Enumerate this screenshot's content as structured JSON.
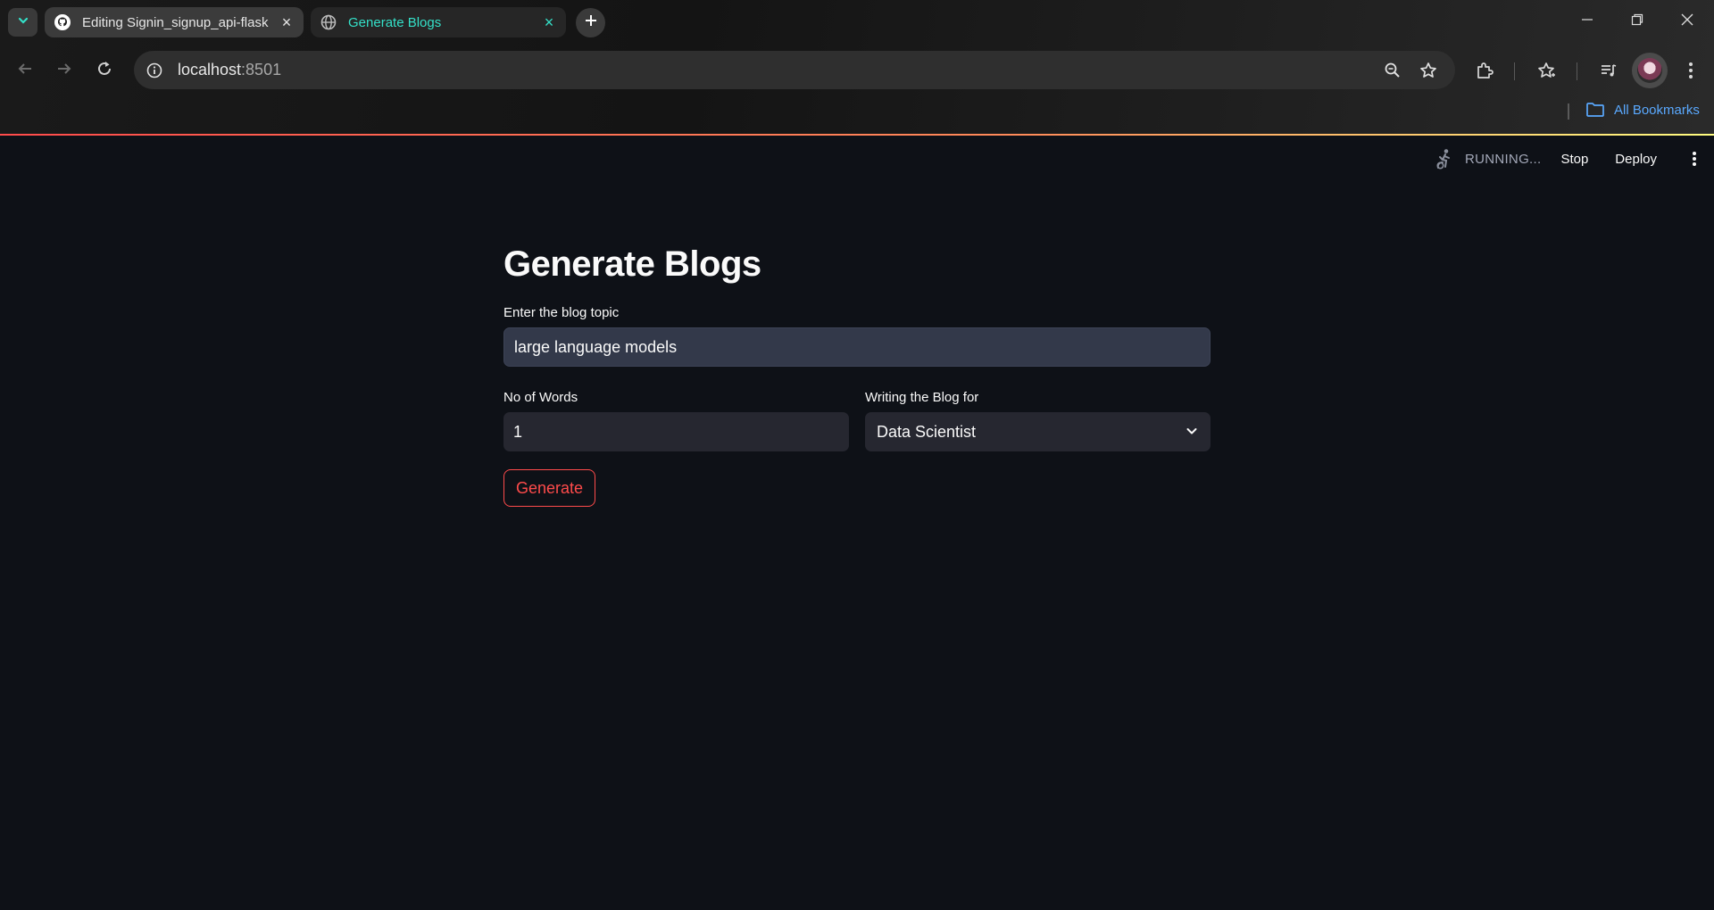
{
  "browser": {
    "tabs": [
      {
        "title": "Editing Signin_signup_api-flask",
        "icon": "github-icon",
        "active": false
      },
      {
        "title": "Generate Blogs",
        "icon": "globe-icon",
        "active": true
      }
    ],
    "url_host": "localhost",
    "url_port": ":8501",
    "bookmarks_label": "All Bookmarks",
    "colors": {
      "active_tab_text": "#34e0c8",
      "bookmark_link": "#5aa9ff"
    }
  },
  "app": {
    "status_text": "RUNNING...",
    "stop_label": "Stop",
    "deploy_label": "Deploy",
    "title": "Generate Blogs",
    "topic": {
      "label": "Enter the blog topic",
      "value": "large language models"
    },
    "words": {
      "label": "No of Words",
      "value": "1"
    },
    "audience": {
      "label": "Writing the Blog for",
      "selected": "Data Scientist"
    },
    "generate_label": "Generate",
    "colors": {
      "background": "#0e1117",
      "accent": "#ff4b4b",
      "input_bg": "#262730"
    }
  }
}
